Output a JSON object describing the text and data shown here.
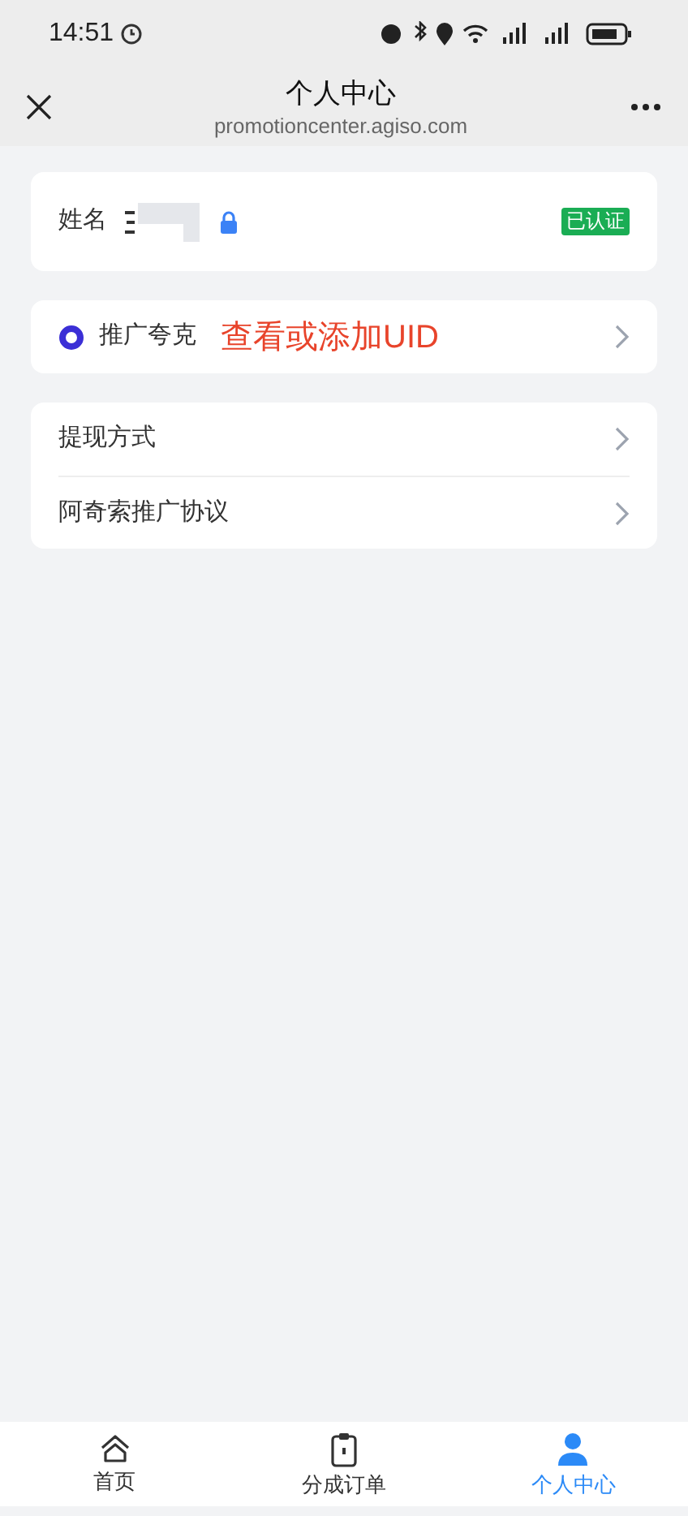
{
  "status_bar": {
    "time": "14:51"
  },
  "header": {
    "title": "个人中心",
    "subtitle": "promotioncenter.agiso.com"
  },
  "profile": {
    "label": "姓名",
    "badge": "已认证",
    "verified": true
  },
  "promoter": {
    "label": "推广夸克",
    "annotation": "查看或添加UID"
  },
  "menu": [
    {
      "label": "提现方式"
    },
    {
      "label": "阿奇索推广协议"
    }
  ],
  "tabs": [
    {
      "label": "首页",
      "kind": "home",
      "selected": false
    },
    {
      "label": "分成订单",
      "kind": "orders",
      "selected": false
    },
    {
      "label": "个人中心",
      "kind": "profile",
      "selected": true
    }
  ]
}
